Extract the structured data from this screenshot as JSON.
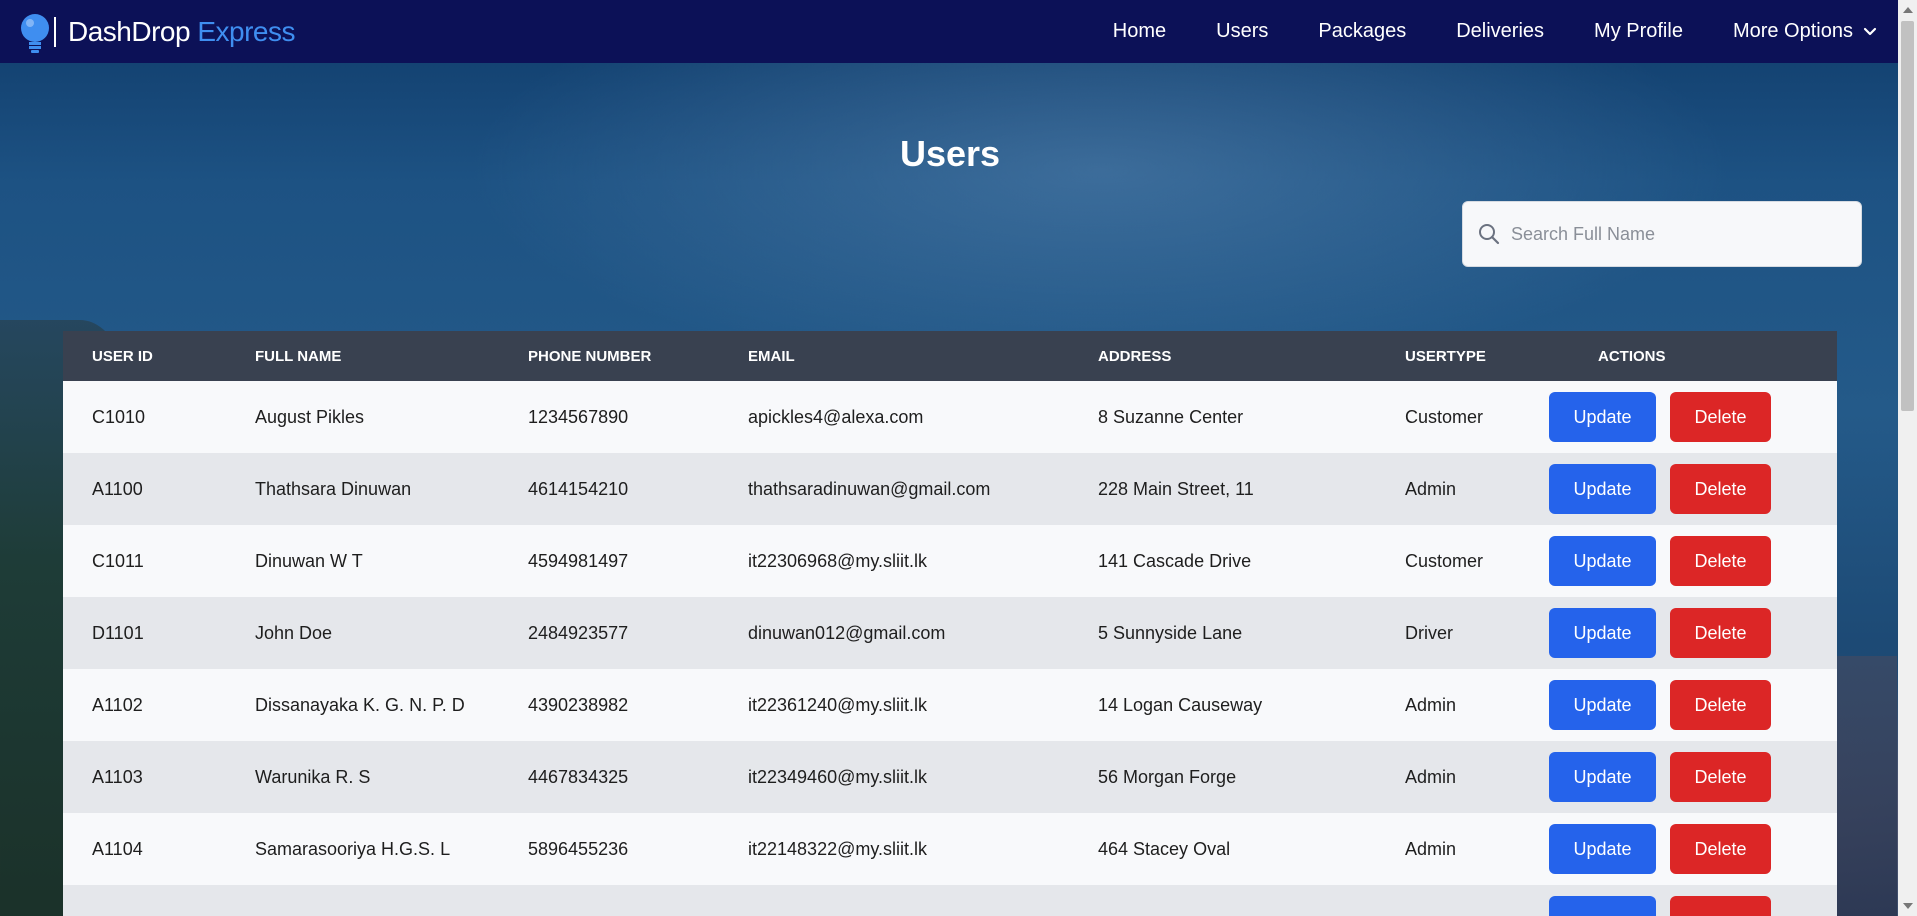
{
  "navbar": {
    "brand_main": "DashDrop",
    "brand_accent": "Express",
    "links": [
      "Home",
      "Users",
      "Packages",
      "Deliveries",
      "My Profile"
    ],
    "more_label": "More Options"
  },
  "page": {
    "title": "Users"
  },
  "search": {
    "placeholder": "Search Full Name",
    "value": ""
  },
  "table": {
    "headers": [
      "User ID",
      "Full Name",
      "Phone Number",
      "Email",
      "Address",
      "UserType",
      "Actions"
    ],
    "update_label": "Update",
    "delete_label": "Delete",
    "rows": [
      {
        "id": "C1010",
        "name": "August Pikles",
        "phone": "1234567890",
        "email": "apickles4@alexa.com",
        "address": "8 Suzanne Center",
        "type": "Customer"
      },
      {
        "id": "A1100",
        "name": "Thathsara Dinuwan",
        "phone": "4614154210",
        "email": "thathsaradinuwan@gmail.com",
        "address": "228 Main Street, 11",
        "type": "Admin"
      },
      {
        "id": "C1011",
        "name": "Dinuwan W T",
        "phone": "4594981497",
        "email": "it22306968@my.sliit.lk",
        "address": "141 Cascade Drive",
        "type": "Customer"
      },
      {
        "id": "D1101",
        "name": "John Doe",
        "phone": "2484923577",
        "email": "dinuwan012@gmail.com",
        "address": "5 Sunnyside Lane",
        "type": "Driver"
      },
      {
        "id": "A1102",
        "name": "Dissanayaka K. G. N. P. D",
        "phone": "4390238982",
        "email": "it22361240@my.sliit.lk",
        "address": "14 Logan Causeway",
        "type": "Admin"
      },
      {
        "id": "A1103",
        "name": "Warunika R. S",
        "phone": "4467834325",
        "email": "it22349460@my.sliit.lk",
        "address": "56 Morgan Forge",
        "type": "Admin"
      },
      {
        "id": "A1104",
        "name": "Samarasooriya H.G.S. L",
        "phone": "5896455236",
        "email": "it22148322@my.sliit.lk",
        "address": "464 Stacey Oval",
        "type": "Admin"
      }
    ]
  },
  "colors": {
    "navbar_bg": "#0c1157",
    "header_bg": "#394150",
    "update_btn": "#2563eb",
    "delete_btn": "#dc2626",
    "brand_accent": "#3f8ef0"
  }
}
